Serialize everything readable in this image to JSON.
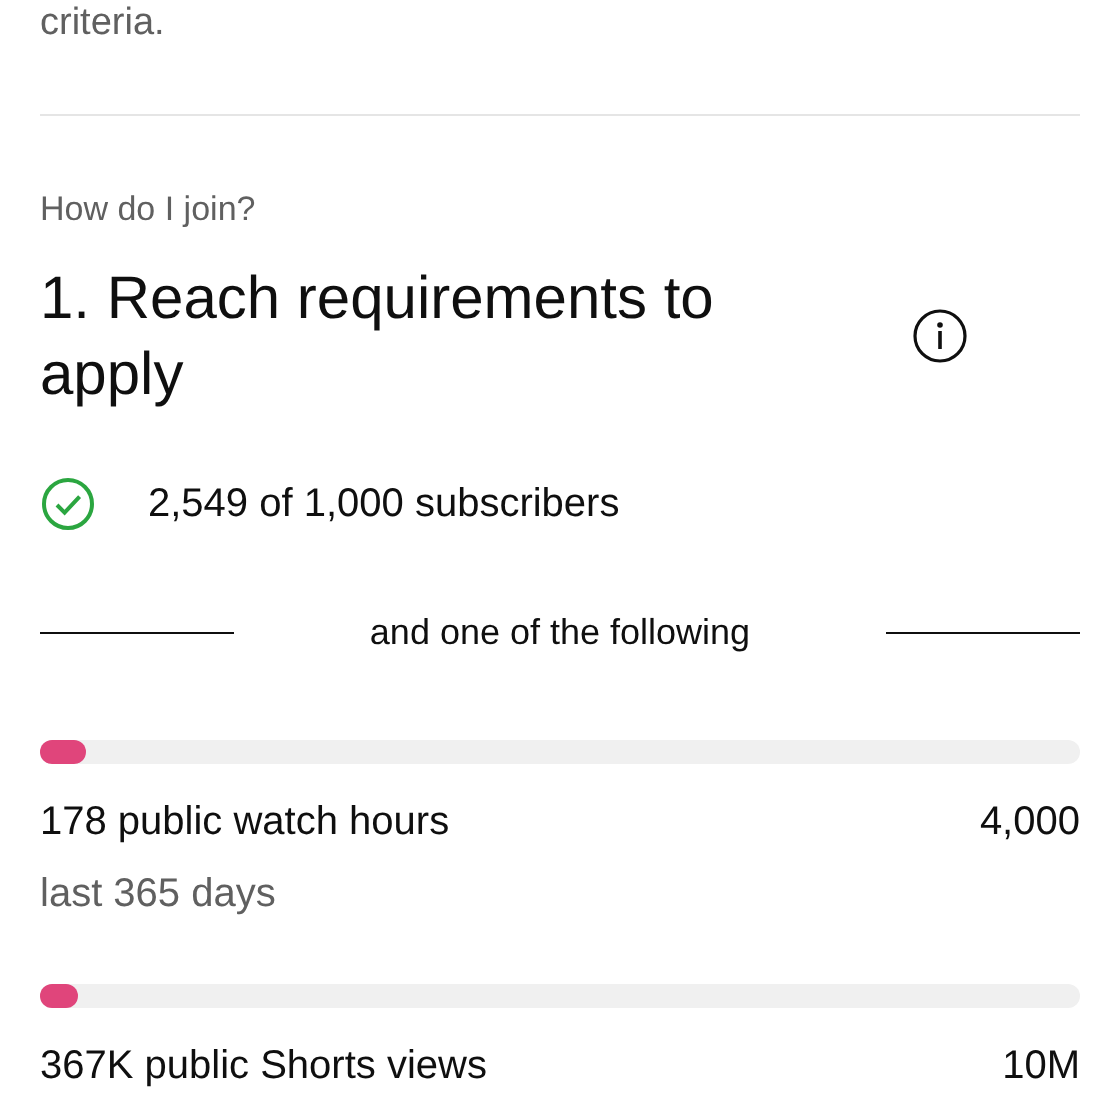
{
  "intro_tail": "criteria.",
  "section_label": "How do I join?",
  "step_title": "1. Reach requirements to apply",
  "subscriber_requirement": {
    "text": "2,549 of 1,000 subscribers",
    "checked": true
  },
  "separator_text": "and one of the following",
  "metrics": [
    {
      "level": 0.045,
      "label": "178 public watch hours",
      "target": "4,000",
      "period": "last 365 days"
    },
    {
      "level": 0.037,
      "label": "367K public Shorts views",
      "target": "10M"
    }
  ]
}
